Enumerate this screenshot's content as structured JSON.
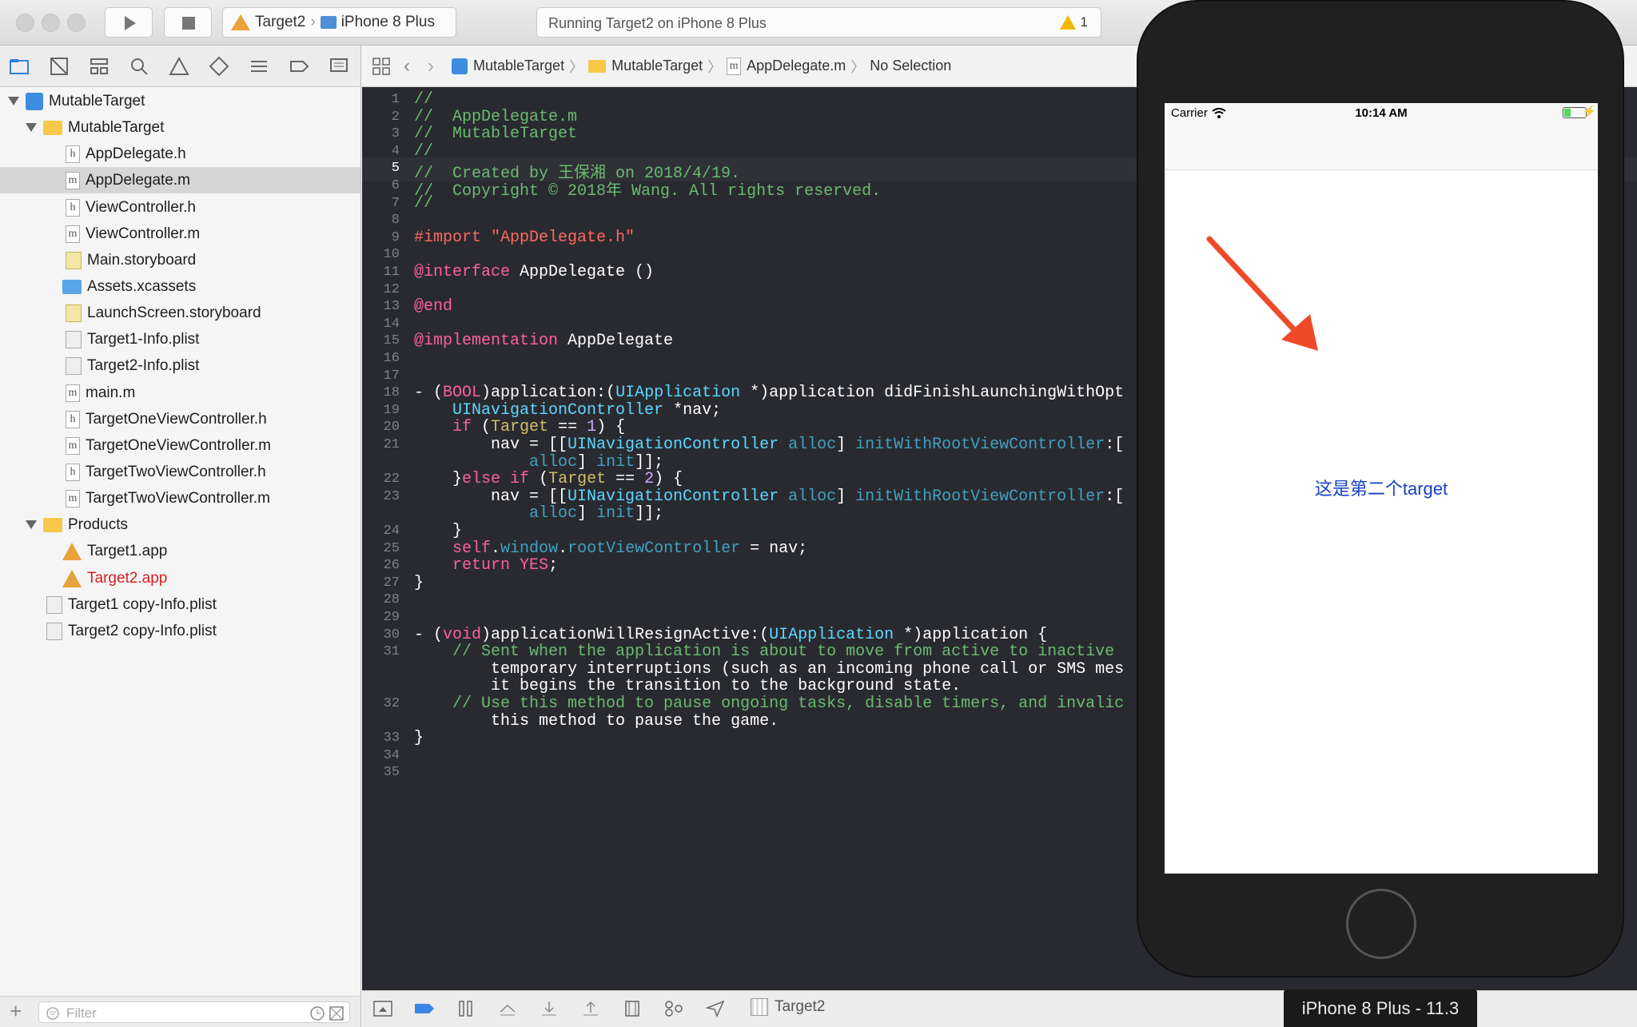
{
  "toolbar": {
    "scheme_target": "Target2",
    "scheme_device": "iPhone 8 Plus",
    "status_text": "Running Target2 on iPhone 8 Plus",
    "warning_count": "1"
  },
  "navigator": {
    "filter_placeholder": "Filter",
    "items": [
      {
        "label": "MutableTarget",
        "type": "project"
      },
      {
        "label": "MutableTarget",
        "type": "folder"
      },
      {
        "label": "AppDelegate.h",
        "type": "h"
      },
      {
        "label": "AppDelegate.m",
        "type": "m",
        "selected": true
      },
      {
        "label": "ViewController.h",
        "type": "h"
      },
      {
        "label": "ViewController.m",
        "type": "m"
      },
      {
        "label": "Main.storyboard",
        "type": "storyboard"
      },
      {
        "label": "Assets.xcassets",
        "type": "assets"
      },
      {
        "label": "LaunchScreen.storyboard",
        "type": "storyboard"
      },
      {
        "label": "Target1-Info.plist",
        "type": "plist"
      },
      {
        "label": "Target2-Info.plist",
        "type": "plist"
      },
      {
        "label": "main.m",
        "type": "m"
      },
      {
        "label": "TargetOneViewController.h",
        "type": "h"
      },
      {
        "label": "TargetOneViewController.m",
        "type": "m"
      },
      {
        "label": "TargetTwoViewController.h",
        "type": "h"
      },
      {
        "label": "TargetTwoViewController.m",
        "type": "m"
      },
      {
        "label": "Products",
        "type": "folder"
      },
      {
        "label": "Target1.app",
        "type": "app"
      },
      {
        "label": "Target2.app",
        "type": "app",
        "missing": true
      },
      {
        "label": "Target1 copy-Info.plist",
        "type": "plist"
      },
      {
        "label": "Target2 copy-Info.plist",
        "type": "plist"
      }
    ]
  },
  "jumpbar": {
    "crumbs": [
      "MutableTarget",
      "MutableTarget",
      "AppDelegate.m",
      "No Selection"
    ]
  },
  "editor": {
    "lines": [
      {
        "n": "1",
        "code": "//"
      },
      {
        "n": "2",
        "code": "//  AppDelegate.m"
      },
      {
        "n": "3",
        "code": "//  MutableTarget"
      },
      {
        "n": "4",
        "code": "//"
      },
      {
        "n": "5",
        "code": "//  Created by 王保湘 on 2018/4/19."
      },
      {
        "n": "6",
        "code": "//  Copyright © 2018年 Wang. All rights reserved."
      },
      {
        "n": "7",
        "code": "//"
      },
      {
        "n": "8",
        "code": ""
      },
      {
        "n": "9",
        "code": "#import \"AppDelegate.h\""
      },
      {
        "n": "10",
        "code": ""
      },
      {
        "n": "11",
        "code": "@interface AppDelegate ()"
      },
      {
        "n": "12",
        "code": ""
      },
      {
        "n": "13",
        "code": "@end"
      },
      {
        "n": "14",
        "code": ""
      },
      {
        "n": "15",
        "code": "@implementation AppDelegate"
      },
      {
        "n": "16",
        "code": ""
      },
      {
        "n": "17",
        "code": ""
      },
      {
        "n": "18",
        "code": "- (BOOL)application:(UIApplication *)application didFinishLaunchingWithOpt"
      },
      {
        "n": "19",
        "code": "    UINavigationController *nav;"
      },
      {
        "n": "20",
        "code": "    if (Target == 1) {"
      },
      {
        "n": "21",
        "code": "        nav = [[UINavigationController alloc] initWithRootViewController:["
      },
      {
        "n": "",
        "code": "            alloc] init]];"
      },
      {
        "n": "22",
        "code": "    }else if (Target == 2) {"
      },
      {
        "n": "23",
        "code": "        nav = [[UINavigationController alloc] initWithRootViewController:["
      },
      {
        "n": "",
        "code": "            alloc] init]];"
      },
      {
        "n": "24",
        "code": "    }"
      },
      {
        "n": "25",
        "code": "    self.window.rootViewController = nav;"
      },
      {
        "n": "26",
        "code": "    return YES;"
      },
      {
        "n": "27",
        "code": "}"
      },
      {
        "n": "28",
        "code": ""
      },
      {
        "n": "29",
        "code": ""
      },
      {
        "n": "30",
        "code": "- (void)applicationWillResignActive:(UIApplication *)application {"
      },
      {
        "n": "31",
        "code": "    // Sent when the application is about to move from active to inactive"
      },
      {
        "n": "",
        "code": "        temporary interruptions (such as an incoming phone call or SMS mes"
      },
      {
        "n": "",
        "code": "        it begins the transition to the background state."
      },
      {
        "n": "32",
        "code": "    // Use this method to pause ongoing tasks, disable timers, and invalic"
      },
      {
        "n": "",
        "code": "        this method to pause the game."
      },
      {
        "n": "33",
        "code": "}"
      },
      {
        "n": "34",
        "code": ""
      },
      {
        "n": "35",
        "code": ""
      }
    ],
    "current_line": "5"
  },
  "debugbar": {
    "target": "Target2"
  },
  "simulator": {
    "carrier": "Carrier",
    "time": "10:14 AM",
    "label": "这是第二个target",
    "device_title": "iPhone 8 Plus - 11.3",
    "arrow_color": "#ee4a2a",
    "label_color": "#1640c6"
  }
}
